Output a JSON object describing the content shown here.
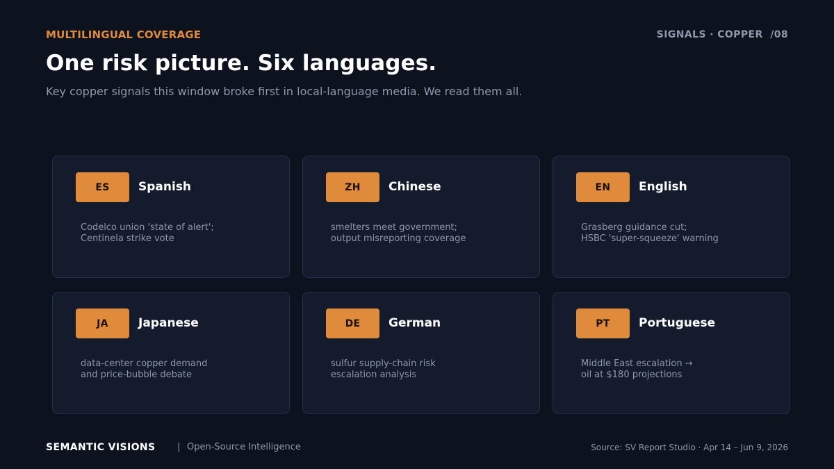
{
  "header": {
    "eyebrow": "MULTILINGUAL COVERAGE",
    "slide_tag": "SIGNALS · COPPER  /08",
    "title": "One risk picture. Six languages.",
    "subtitle": "Key copper signals this window broke first in local-language media. We read them all."
  },
  "cards": [
    {
      "code": "ES",
      "language": "Spanish",
      "lines": [
        "Codelco union 'state of alert';",
        "Centinela strike vote"
      ]
    },
    {
      "code": "ZH",
      "language": "Chinese",
      "lines": [
        "smelters meet government;",
        "output misreporting coverage"
      ]
    },
    {
      "code": "EN",
      "language": "English",
      "lines": [
        "Grasberg guidance cut;",
        "HSBC 'super-squeeze' warning"
      ]
    },
    {
      "code": "JA",
      "language": "Japanese",
      "lines": [
        "data-center copper demand",
        "and price-bubble debate"
      ]
    },
    {
      "code": "DE",
      "language": "German",
      "lines": [
        "sulfur supply-chain risk",
        "escalation analysis"
      ]
    },
    {
      "code": "PT",
      "language": "Portuguese",
      "lines": [
        "Middle East escalation →",
        "oil at $180 projections"
      ]
    }
  ],
  "footer": {
    "brand": "SEMANTIC VISIONS",
    "separator": "|",
    "tagline": "Open-Source Intelligence",
    "source": "Source: SV Report Studio · Apr 14 – Jun 9, 2026"
  },
  "colors": {
    "background": "#0c121e",
    "card": "#131b2d",
    "accent": "#e08a3c",
    "muted_text": "#8f98ab"
  }
}
